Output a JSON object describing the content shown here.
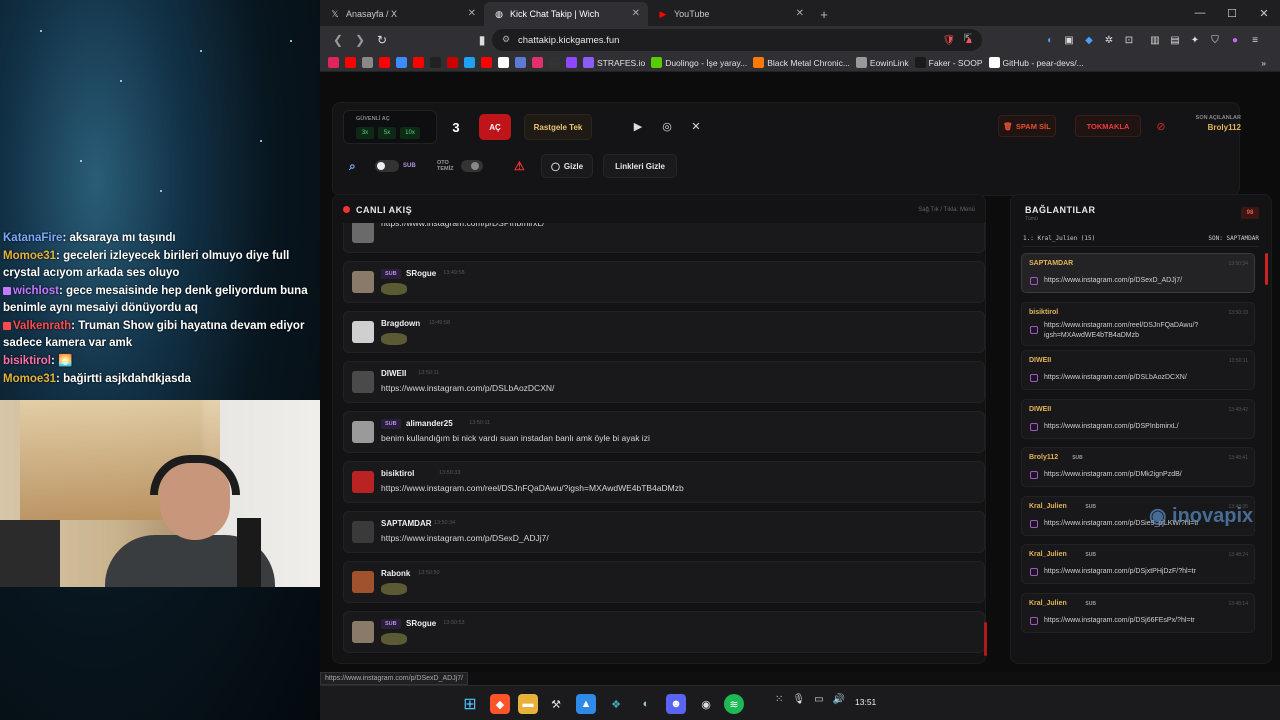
{
  "stream": {
    "chat": [
      {
        "user": "KatanaFire",
        "color": "#7aa8ff",
        "text": ": aksaraya mı taşındı",
        "badge": false
      },
      {
        "user": "Momoe31",
        "color": "#e2b23b",
        "text": ": geceleri izleyecek birileri olmuyo diye full crystal acıyom arkada ses oluyo",
        "badge": false
      },
      {
        "user": "wichlost",
        "color": "#c479ff",
        "text": ": gece mesaisinde hep denk geliyordum buna benimle aynı mesaiyi dönüyordu aq",
        "badge": true
      },
      {
        "user": "Valkenrath",
        "color": "#ff4a4a",
        "text": ": Truman Show gibi hayatına devam ediyor sadece kamera var amk",
        "badge": true
      },
      {
        "user": "bisiktirol",
        "color": "#ff6fa8",
        "text": ": 🌅",
        "badge": false
      },
      {
        "user": "Momoe31",
        "color": "#e2b23b",
        "text": ": bağirtti asjkdahdkjasda",
        "badge": false
      }
    ]
  },
  "browser": {
    "tabs": [
      {
        "label": "Anasayfa / X",
        "icon": "x-logo-icon",
        "active": false
      },
      {
        "label": "Kick Chat Takip | Wich",
        "icon": "globe-icon",
        "active": true
      },
      {
        "label": "YouTube",
        "icon": "youtube-icon",
        "active": false
      }
    ],
    "url": "chattakip.kickgames.fun",
    "bookmarks": [
      {
        "label": "",
        "color": "#e0245e"
      },
      {
        "label": "",
        "color": "#ff0000"
      },
      {
        "label": "",
        "color": "#888"
      },
      {
        "label": "",
        "color": "#ff0000"
      },
      {
        "label": "",
        "color": "#3d8bfd"
      },
      {
        "label": "",
        "color": "#ff0000"
      },
      {
        "label": "",
        "color": "#222"
      },
      {
        "label": "",
        "color": "#c00"
      },
      {
        "label": "",
        "color": "#1da1f2"
      },
      {
        "label": "",
        "color": "#ff0000"
      },
      {
        "label": "",
        "color": "#fff"
      },
      {
        "label": "",
        "color": "#5b7bd5"
      },
      {
        "label": "",
        "color": "#e1306c"
      },
      {
        "label": "",
        "color": "#333"
      },
      {
        "label": "",
        "color": "#9146ff"
      },
      {
        "label": "STRAFES.io",
        "color": "#8b5cf6"
      },
      {
        "label": "Duolingo - İşe yaray...",
        "color": "#58cc02"
      },
      {
        "label": "Black Metal Chronic...",
        "color": "#ff7a00"
      },
      {
        "label": "EowinLink",
        "color": "#999"
      },
      {
        "label": "Faker - SOOP",
        "color": "#1a1a1a"
      },
      {
        "label": "GitHub - pear-devs/...",
        "color": "#fff"
      }
    ],
    "status_url": "https://www.instagram.com/p/DSexD_ADJj7/"
  },
  "controls": {
    "guvenli_label": "GÜVENLİ AÇ",
    "multipliers": [
      "3x",
      "5x",
      "10x"
    ],
    "count": "3",
    "open_label": "AÇ",
    "random_label": "Rastgele Tek",
    "spam_label": "SPAM SİL",
    "tokmakla_label": "TOKMAKLA",
    "last_opened_label": "SON AÇILANLAR",
    "last_opened_value": "Broly112",
    "sub_label": "SUB",
    "oto_temiz_label": "OTO TEMİZ",
    "gizle_label": "Gizle",
    "linkleri_gizle_label": "Linkleri Gizle"
  },
  "feed": {
    "title": "CANLI AKIŞ",
    "hint": "Sağ Tık / Tıkla: Menü",
    "messages": [
      {
        "user": "",
        "time": "",
        "text": "https://www.instagram.com/p/DSPInbmirxL/",
        "sub": false,
        "emote": false,
        "avatar": "#6a6a6a",
        "partial": true
      },
      {
        "user": "SRogue",
        "time": "13:49:58",
        "text": "",
        "sub": true,
        "emote": true,
        "avatar": "#8a7a6a"
      },
      {
        "user": "Bragdown",
        "time": "13:49:58",
        "text": "",
        "sub": false,
        "emote": true,
        "avatar": "#cfcfcf"
      },
      {
        "user": "DIWEII",
        "time": "13:50:11",
        "text": "https://www.instagram.com/p/DSLbAozDCXN/",
        "sub": false,
        "emote": false,
        "avatar": "#4a4a4a"
      },
      {
        "user": "alimander25",
        "time": "13:50:11",
        "text": "benim kullandığım bi nick vardı suan instadan banlı amk öyle bi ayak izi",
        "sub": true,
        "emote": false,
        "avatar": "#9a9a9a"
      },
      {
        "user": "bisiktirol",
        "time": "13:50:33",
        "text": "https://www.instagram.com/reel/DSJnFQaDAwu/?igsh=MXAwdWE4bTB4aDMzb",
        "sub": false,
        "emote": false,
        "avatar": "#b22"
      },
      {
        "user": "SAPTAMDAR",
        "time": "13:50:34",
        "text": "https://www.instagram.com/p/DSexD_ADJj7/",
        "sub": false,
        "emote": false,
        "avatar": "#3a3a3a"
      },
      {
        "user": "Rabonk",
        "time": "13:50:50",
        "text": "",
        "sub": false,
        "emote": true,
        "avatar": "#a0522d"
      },
      {
        "user": "SRogue",
        "time": "13:50:53",
        "text": "",
        "sub": true,
        "emote": true,
        "avatar": "#8a7a6a"
      }
    ]
  },
  "links": {
    "title": "BAĞLANTILAR",
    "subtitle": "Tümü",
    "count": "98",
    "ticker_left": "1.: Kral_Julien (15)",
    "ticker_right": "SON: SAPTAMDAR",
    "items": [
      {
        "user": "SAPTAMDAR",
        "sub": false,
        "time": "13:50:34",
        "url": "https://www.instagram.com/p/DSexD_ADJj7/",
        "highlight": true
      },
      {
        "user": "bisiktirol",
        "sub": false,
        "time": "13:50:33",
        "url": "https://www.instagram.com/reel/DSJnFQaDAwu/?igsh=MXAwdWE4bTB4aDMzb",
        "highlight": false
      },
      {
        "user": "DIWEII",
        "sub": false,
        "time": "13:50:11",
        "url": "https://www.instagram.com/p/DSLbAozDCXN/",
        "highlight": false
      },
      {
        "user": "DIWEII",
        "sub": false,
        "time": "13:49:42",
        "url": "https://www.instagram.com/p/DSPInbmirxL/",
        "highlight": false
      },
      {
        "user": "Broly112",
        "sub": true,
        "time": "13:48:41",
        "url": "https://www.instagram.com/p/DMk2ignPzdB/",
        "highlight": false
      },
      {
        "user": "Kral_Julien",
        "sub": true,
        "time": "13:48:35",
        "url": "https://www.instagram.com/p/DSie9_pjLKW/?hl=tr",
        "highlight": false
      },
      {
        "user": "Kral_Julien",
        "sub": true,
        "time": "13:48:24",
        "url": "https://www.instagram.com/p/DSjxtPHjDzF/?hl=tr",
        "highlight": false
      },
      {
        "user": "Kral_Julien",
        "sub": true,
        "time": "13:48:14",
        "url": "https://www.instagram.com/p/DSj66FEsPx/?hl=tr",
        "highlight": false
      }
    ],
    "sub_badge": "SUB"
  },
  "watermark": "inovapix",
  "taskbar": {
    "time": "13:51"
  }
}
